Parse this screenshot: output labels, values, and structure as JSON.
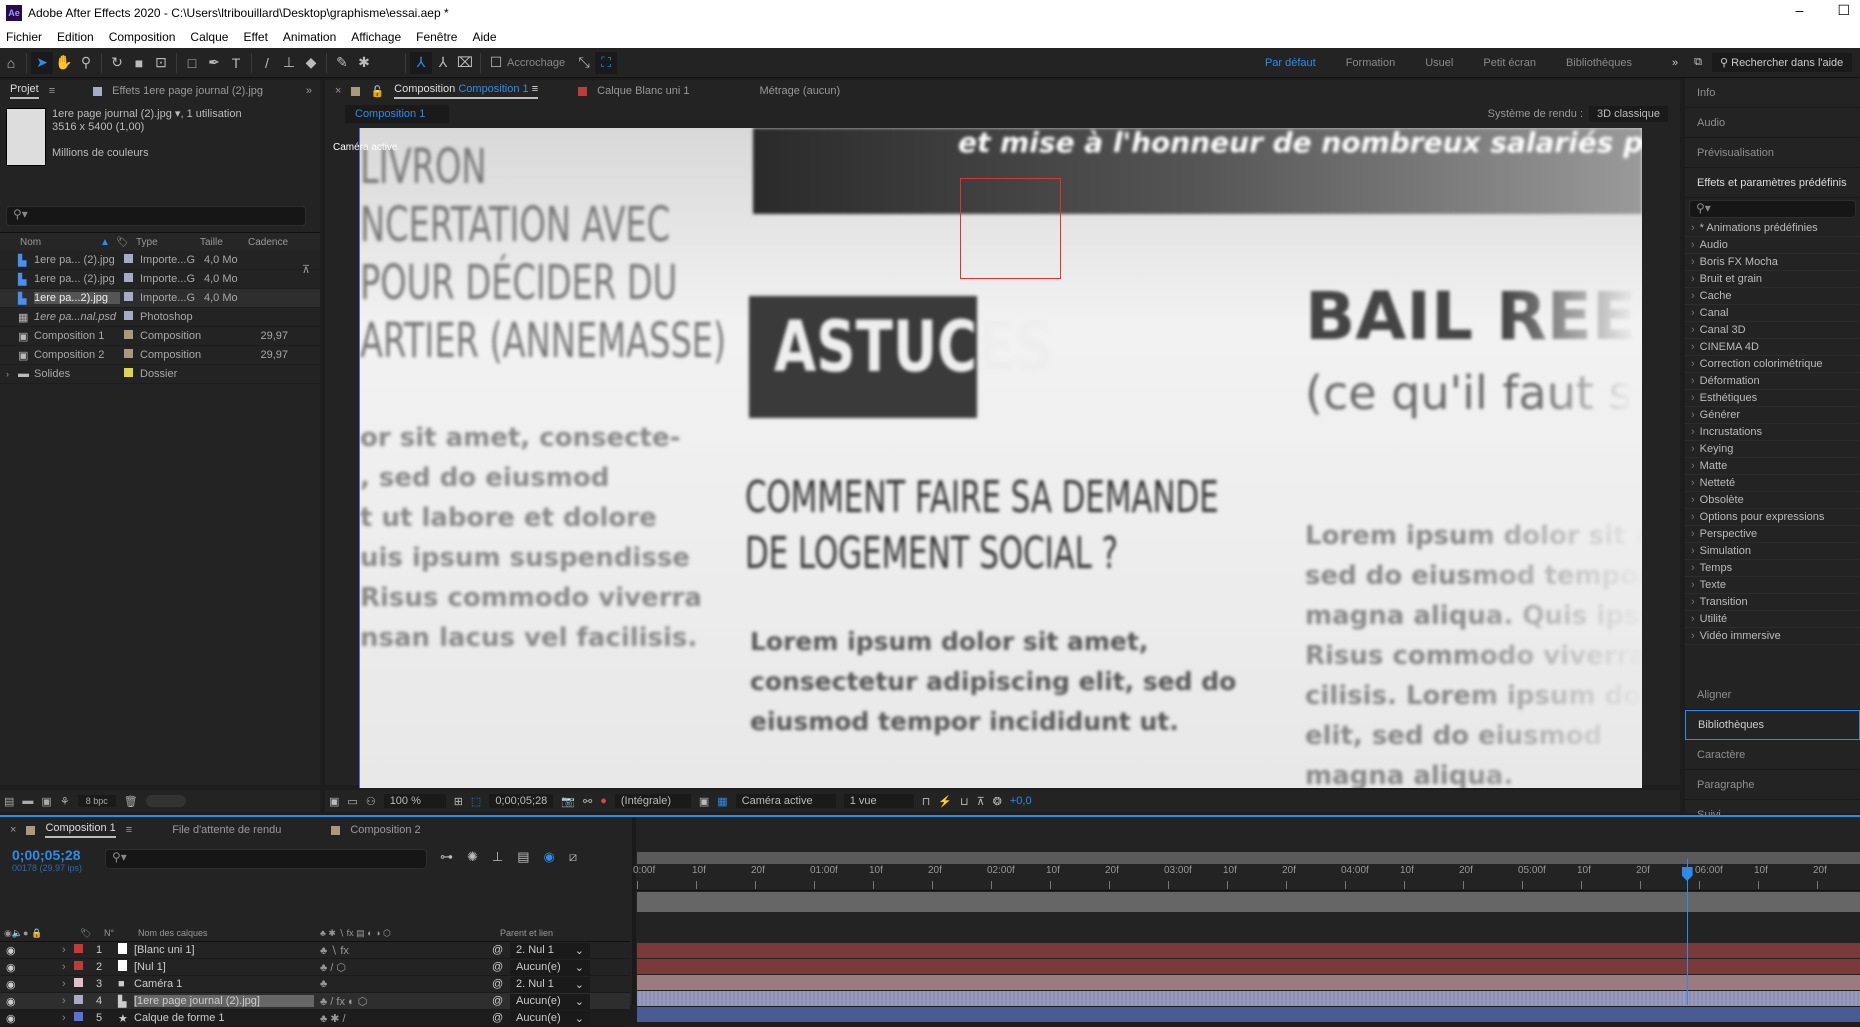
{
  "title_bar": {
    "app_icon": "Ae",
    "title": "Adobe After Effects 2020 - C:\\Users\\ltribouillard\\Desktop\\graphisme\\essai.aep *",
    "minimize": "–",
    "maximize": "☐"
  },
  "menu": [
    "Fichier",
    "Edition",
    "Composition",
    "Calque",
    "Effet",
    "Animation",
    "Affichage",
    "Fenêtre",
    "Aide"
  ],
  "toolbar": {
    "snap_label": "Accrochage",
    "workspaces": [
      "Par défaut",
      "Formation",
      "Usuel",
      "Petit écran",
      "Bibliothèques"
    ],
    "active_workspace": "Par défaut",
    "help_search": "Rechercher dans l'aide"
  },
  "project": {
    "tab": "Projet",
    "effects_tab": "Effets  1ere page journal (2).jpg",
    "asset_name": "1ere page journal (2).jpg",
    "asset_usage": ", 1 utilisation",
    "asset_dims": "3516 x 5400 (1,00)",
    "asset_colors": "Millions de couleurs",
    "columns": [
      "Nom",
      "Type",
      "Taille",
      "Cadence"
    ],
    "items": [
      {
        "name": "1ere pa... (2).jpg",
        "type": "Importe...G",
        "size": "4,0 Mo",
        "rate": "",
        "icon": "image-file-icon",
        "color": "#a9a9c8"
      },
      {
        "name": "1ere pa... (2).jpg",
        "type": "Importe...G",
        "size": "4,0 Mo",
        "rate": "",
        "icon": "image-file-icon",
        "color": "#a9a9c8"
      },
      {
        "name": "1ere pa...2).jpg",
        "type": "Importe...G",
        "size": "4,0 Mo",
        "rate": "",
        "icon": "image-file-icon",
        "color": "#a9a9c8"
      },
      {
        "name": "1ere pa...nal.psd",
        "type": "Photoshop",
        "size": "",
        "rate": "",
        "icon": "psd-file-icon",
        "color": "#a9a9c8"
      },
      {
        "name": "Composition 1",
        "type": "Composition",
        "size": "",
        "rate": "29,97",
        "icon": "composition-icon",
        "color": "#a89a7c"
      },
      {
        "name": "Composition 2",
        "type": "Composition",
        "size": "",
        "rate": "29,97",
        "icon": "composition-icon",
        "color": "#a89a7c"
      },
      {
        "name": "Solides",
        "type": "Dossier",
        "size": "",
        "rate": "",
        "icon": "folder-icon",
        "color": "#e0d44c"
      }
    ],
    "bpc": "8 bpc"
  },
  "viewer": {
    "tab_prefix": "Composition",
    "tab_name": "Composition 1",
    "layer_tab": "Calque  Blanc uni 1",
    "footage_tab": "Métrage  (aucun)",
    "breadcrumb": "Composition 1",
    "renderer_label": "Système de rendu :",
    "renderer": "3D  classique",
    "camera_label": "Caméra active",
    "content": {
      "banner": "et mise à l'honneur de nombreux salariés par l",
      "left_title": [
        "LIVRON",
        "NCERTATION AVEC",
        "POUR DÉCIDER DU",
        "ARTIER (ANNEMASSE)"
      ],
      "left_body": [
        "or sit amet, consecte-",
        ", sed do eiusmod",
        "t ut labore et dolore",
        "uis ipsum suspendisse",
        "Risus commodo viverra",
        "nsan lacus vel facilisis."
      ],
      "astuces": "ASTUCES",
      "headline": [
        "COMMENT FAIRE SA DEMANDE",
        "DE LOGEMENT SOCIAL ?"
      ],
      "body": [
        "Lorem ipsum dolor sit amet,",
        "consectetur adipiscing elit, sed do",
        "eiusmod tempor incididunt ut."
      ],
      "right_title": "BAIL REE",
      "right_sub": "(ce qu'il faut s",
      "right_body": [
        "Lorem ipsum dolor sit am",
        "sed do eiusmod tempor",
        "magna aliqua. Quis ipsum",
        "Risus commodo viverra",
        "cilisis. Lorem ipsum dolo",
        "elit, sed do eiusmod",
        "magna aliqua."
      ]
    },
    "controls": {
      "zoom": "100 %",
      "timecode": "0;00;05;28",
      "resolution": "(Intégrale)",
      "camera": "Caméra active",
      "views": "1 vue",
      "exposure": "+0,0"
    }
  },
  "right_panel": {
    "top": [
      "Info",
      "Audio",
      "Prévisualisation"
    ],
    "effects_title": "Effets et paramètres prédéfinis",
    "effects": [
      "* Animations prédéfinies",
      "Audio",
      "Boris FX Mocha",
      "Bruit et grain",
      "Cache",
      "Canal",
      "Canal 3D",
      "CINEMA 4D",
      "Correction colorimétrique",
      "Déformation",
      "Esthétiques",
      "Générer",
      "Incrustations",
      "Keying",
      "Matte",
      "Netteté",
      "Obsolète",
      "Options pour expressions",
      "Perspective",
      "Simulation",
      "Temps",
      "Texte",
      "Transition",
      "Utilité",
      "Vidéo immersive"
    ],
    "bottom": [
      "Aligner",
      "Bibliothèques",
      "Caractère",
      "Paragraphe",
      "Suivi"
    ],
    "active_bottom": "Bibliothèques"
  },
  "timeline": {
    "tabs": [
      "Composition 1",
      "File d'attente de rendu",
      "Composition 2"
    ],
    "timecode": "0;00;05;28",
    "frame_info": "00178 (29.97 ips)",
    "col_num": "N°",
    "col_name": "Nom des calques",
    "col_parent": "Parent et lien",
    "ruler": [
      "0:00f",
      "10f",
      "20f",
      "01:00f",
      "10f",
      "20f",
      "02:00f",
      "10f",
      "20f",
      "03:00f",
      "10f",
      "20f",
      "04:00f",
      "10f",
      "20f",
      "05:00f",
      "10f",
      "20f",
      "06:00f",
      "10f",
      "20f"
    ],
    "playhead_seconds": 5.93,
    "layers": [
      {
        "num": "1",
        "name": "[Blanc uni 1]",
        "label": "#c43a3a",
        "parent": "2. Nul 1",
        "bar": "#7a3a3a",
        "icon": "solid-icon"
      },
      {
        "num": "2",
        "name": "[Nul 1]",
        "label": "#c43a3a",
        "parent": "Aucun(e)",
        "bar": "#7a3a3a",
        "icon": "null-icon"
      },
      {
        "num": "3",
        "name": "Caméra 1",
        "label": "#e4bcc8",
        "parent": "2. Nul 1",
        "bar": "#9a7b80",
        "icon": "camera-icon"
      },
      {
        "num": "4",
        "name": "[1ere page journal (2).jpg]",
        "label": "#a9a9c8",
        "parent": "Aucun(e)",
        "bar": "#8f8fb0",
        "icon": "image-file-icon"
      },
      {
        "num": "5",
        "name": "Calque de forme 1",
        "label": "#5a73d6",
        "parent": "Aucun(e)",
        "bar": "#4a5a92",
        "icon": "star-icon"
      }
    ]
  }
}
